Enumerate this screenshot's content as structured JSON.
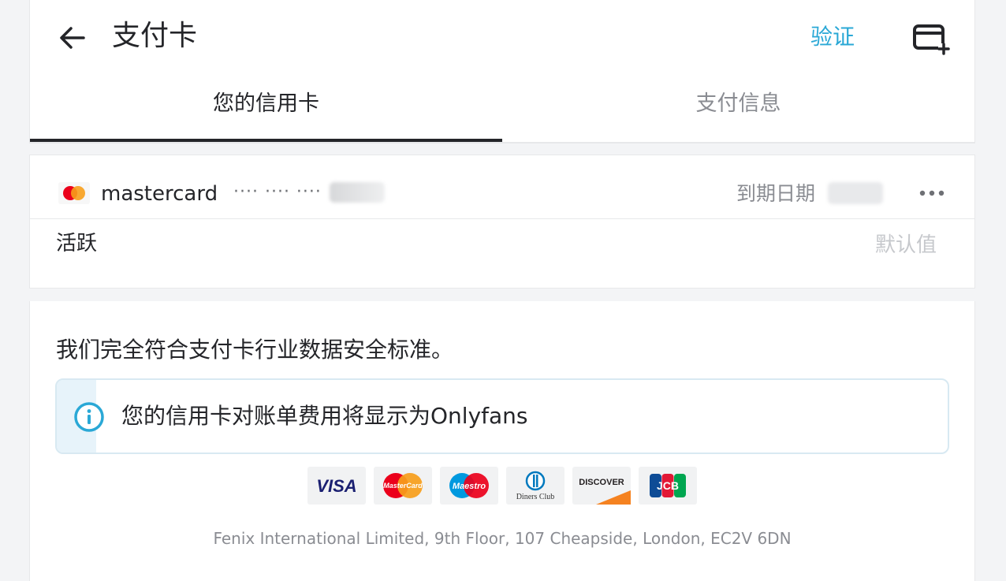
{
  "header": {
    "title": "支付卡",
    "verify_label": "验证",
    "back_icon": "arrow-left-icon",
    "add_card_icon": "card-plus-icon"
  },
  "tabs": [
    {
      "label": "您的信用卡",
      "active": true
    },
    {
      "label": "支付信息",
      "active": false
    }
  ],
  "card": {
    "brand": "mastercard",
    "masked_number": "···· ···· ····",
    "expiry_label": "到期日期",
    "status": "活跃",
    "default_label": "默认值",
    "more_icon": "more-horizontal-icon"
  },
  "security": {
    "statement": "我们完全符合支付卡行业数据安全标准。",
    "notice": "您的信用卡对账单费用将显示为Onlyfans",
    "notice_icon": "info-icon"
  },
  "accepted_cards": {
    "visa": "VISA",
    "mastercard": "MasterCard",
    "maestro": "Maestro",
    "diners": "Diners Club",
    "discover": "DISCOVER",
    "jcb": "JCB"
  },
  "footer": {
    "address": "Fenix International Limited, 9th Floor, 107 Cheapside, London, EC2V 6DN"
  },
  "colors": {
    "accent": "#2aa8d6",
    "text": "#242529",
    "muted": "#8a8c92"
  }
}
